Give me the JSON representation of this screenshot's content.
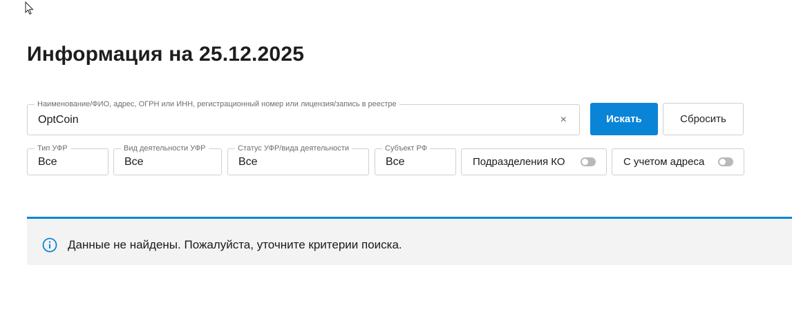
{
  "page": {
    "title": "Информация на 25.12.2025"
  },
  "search": {
    "label": "Наименование/ФИО, адрес, ОГРН или ИНН, регистрационный номер или лицензия/запись в реестре",
    "value": "OptCoin",
    "clear_symbol": "×",
    "search_button": "Искать",
    "reset_button": "Сбросить"
  },
  "filters": [
    {
      "label": "Тип УФР",
      "value": "Все"
    },
    {
      "label": "Вид деятельности УФР",
      "value": "Все"
    },
    {
      "label": "Статус УФР/вида деятельности",
      "value": "Все"
    },
    {
      "label": "Субъект РФ",
      "value": "Все"
    }
  ],
  "toggles": [
    {
      "label": "Подразделения КО",
      "on": false
    },
    {
      "label": "С учетом адреса",
      "on": false
    }
  ],
  "notice": {
    "message": "Данные не найдены. Пожалуйста, уточните критерии поиска."
  },
  "colors": {
    "accent": "#0a84d6",
    "notice_bg": "#f3f3f3",
    "border": "#cfcfcf"
  },
  "icons": {
    "cursor": "mouse-pointer-icon",
    "info": "info-circle-icon",
    "clear": "close-icon"
  }
}
